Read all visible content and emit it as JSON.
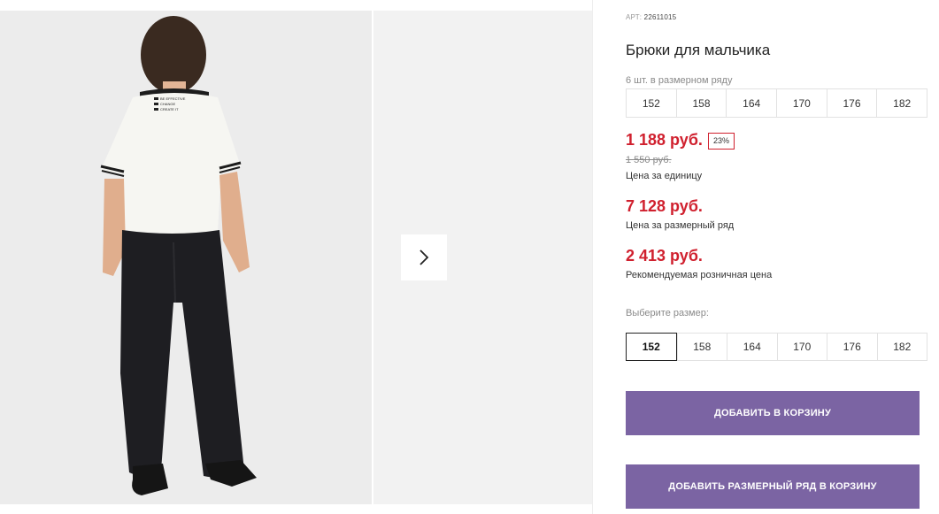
{
  "product": {
    "art_label": "АРТ:",
    "art_value": "22611015",
    "title": "Брюки для мальчика",
    "row_note": "6 шт. в размерном ряду"
  },
  "size_row": [
    "152",
    "158",
    "164",
    "170",
    "176",
    "182"
  ],
  "prices": {
    "unit_price": "1 188 руб.",
    "discount_badge": "23%",
    "old_price": "1 550 руб.",
    "unit_caption": "Цена за единицу",
    "row_price": "7 128 руб.",
    "row_caption": "Цена за размерный ряд",
    "retail_price": "2 413 руб.",
    "retail_caption": "Рекомендуемая розничная цена"
  },
  "size_select": {
    "label": "Выберите размер:",
    "options": [
      "152",
      "158",
      "164",
      "170",
      "176",
      "182"
    ],
    "selected": "152"
  },
  "actions": {
    "add_to_cart": "ДОБАВИТЬ В КОРЗИНУ",
    "add_row_to_cart": "ДОБАВИТЬ РАЗМЕРНЫЙ РЯД В КОРЗИНУ"
  },
  "shirt_print": [
    "BE EFFECTIVE",
    "CHANGE",
    "CREATE IT"
  ],
  "colors": {
    "accent_red": "#d0202e",
    "button_purple": "#7b64a3"
  },
  "icons": {
    "gallery_next": "chevron-right-icon"
  }
}
